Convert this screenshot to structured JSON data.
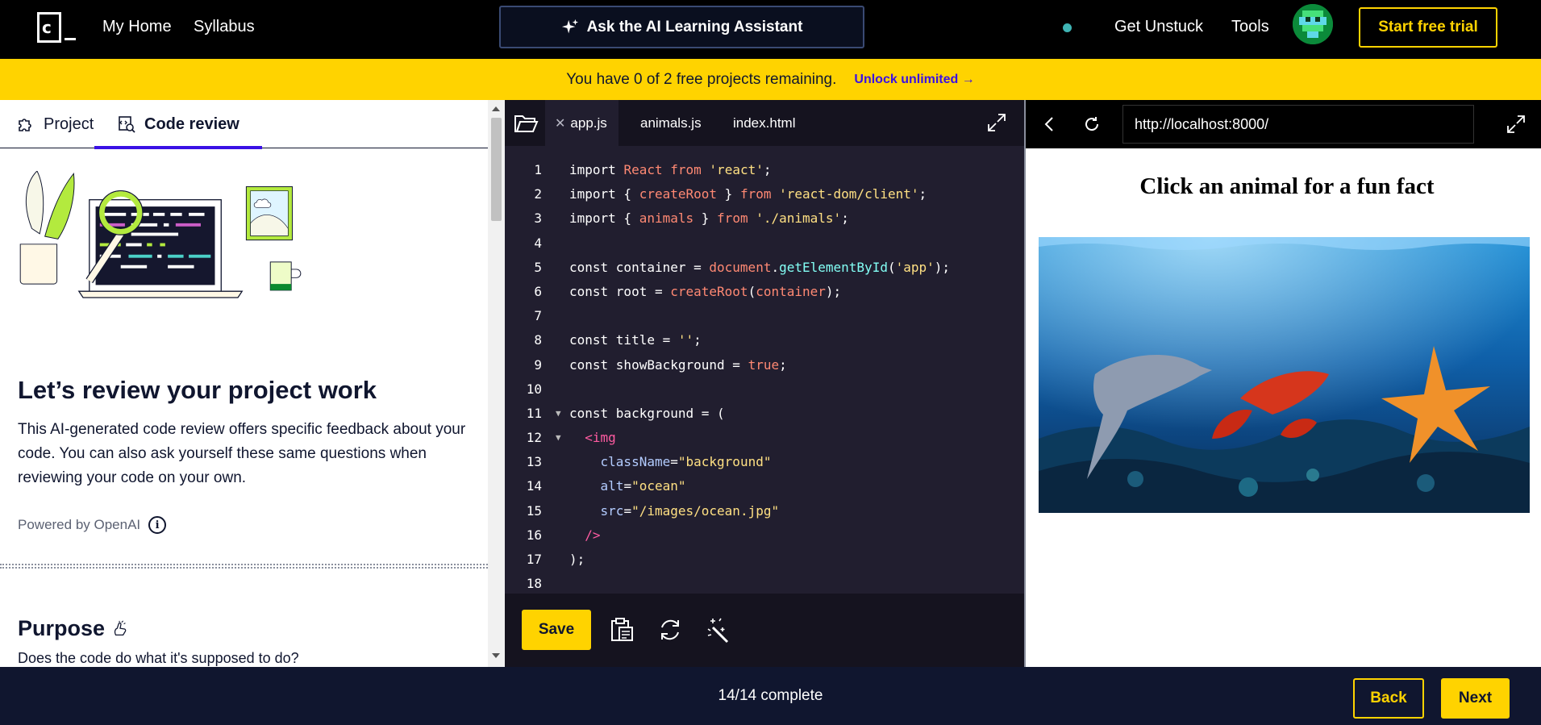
{
  "nav": {
    "logo_letter": "c",
    "links": [
      "My Home",
      "Syllabus"
    ],
    "ai_button": "Ask the AI Learning Assistant",
    "get_unstuck": "Get Unstuck",
    "tools": "Tools",
    "trial_button": "Start free trial",
    "status_dot_color": "#3fb4b4"
  },
  "banner": {
    "message": "You have 0 of 2 free projects remaining.",
    "unlock": "Unlock unlimited →"
  },
  "left": {
    "tabs": [
      {
        "label": "Project",
        "icon": "puzzle-icon"
      },
      {
        "label": "Code review",
        "icon": "code-review-icon",
        "active": true
      }
    ],
    "title": "Let’s review your project work",
    "description": "This AI-generated code review offers specific feedback about your code. You can also ask yourself these same questions when reviewing your code on your own.",
    "powered_by": "Powered by OpenAI",
    "section_title": "Purpose",
    "section_question": "Does the code do what it's supposed to do?"
  },
  "editor": {
    "tabs": [
      {
        "label": "app.js",
        "active": true,
        "closable": true
      },
      {
        "label": "animals.js"
      },
      {
        "label": "index.html"
      }
    ],
    "line_numbers": [
      "1",
      "2",
      "3",
      "4",
      "5",
      "6",
      "7",
      "8",
      "9",
      "10",
      "11",
      "12",
      "13",
      "14",
      "15",
      "16",
      "17",
      "18"
    ],
    "save_button": "Save"
  },
  "preview": {
    "url": "http://localhost:8000/",
    "heading": "Click an animal for a fun fact",
    "image_alt": "ocean"
  },
  "footer": {
    "progress": "14/14 complete",
    "back": "Back",
    "next": "Next"
  },
  "colors": {
    "accent_yellow": "#ffd300",
    "accent_purple": "#3a10e5",
    "navy": "#10162f",
    "editor_bg": "#211e2f"
  }
}
